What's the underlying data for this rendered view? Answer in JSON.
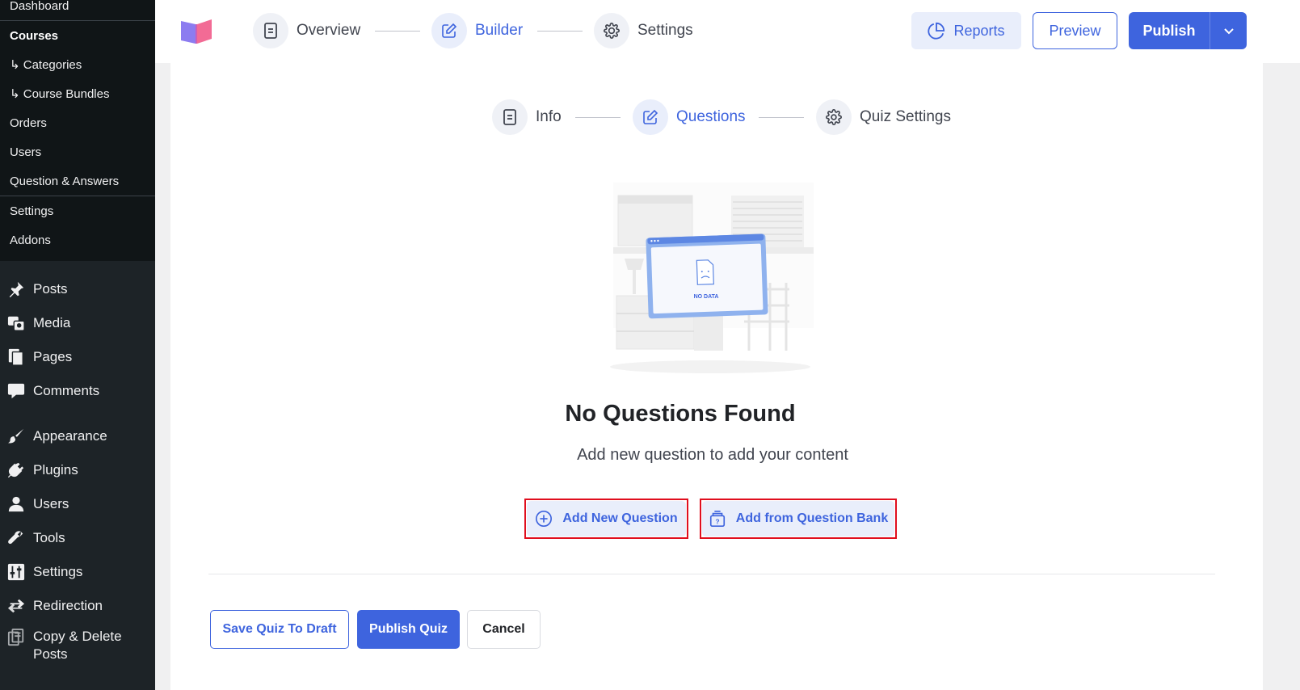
{
  "sidebar": {
    "submenu": [
      {
        "label": "Dashboard",
        "current": false
      },
      {
        "label": "Courses",
        "current": true
      },
      {
        "label": "↳ Categories",
        "current": false
      },
      {
        "label": "↳ Course Bundles",
        "current": false
      },
      {
        "label": "Orders",
        "current": false
      },
      {
        "label": "Users",
        "current": false
      },
      {
        "label": "Question & Answers",
        "current": false
      },
      {
        "label": "Settings",
        "current": false
      },
      {
        "label": "Addons",
        "current": false
      }
    ],
    "menu": [
      {
        "label": "Posts",
        "icon": "pin-icon"
      },
      {
        "label": "Media",
        "icon": "media-icon"
      },
      {
        "label": "Pages",
        "icon": "pages-icon"
      },
      {
        "label": "Comments",
        "icon": "comment-icon"
      },
      {
        "label": "Appearance",
        "icon": "brush-icon"
      },
      {
        "label": "Plugins",
        "icon": "plug-icon"
      },
      {
        "label": "Users",
        "icon": "user-icon"
      },
      {
        "label": "Tools",
        "icon": "wrench-icon"
      },
      {
        "label": "Settings",
        "icon": "sliders-icon"
      },
      {
        "label": "Redirection",
        "icon": "redirect-icon"
      },
      {
        "label": "Copy & Delete Posts",
        "icon": "copy-icon"
      }
    ]
  },
  "header": {
    "steps": [
      {
        "label": "Overview",
        "icon": "document-icon",
        "active": false
      },
      {
        "label": "Builder",
        "icon": "edit-icon",
        "active": true
      },
      {
        "label": "Settings",
        "icon": "gear-icon",
        "active": false
      }
    ],
    "reports_label": "Reports",
    "preview_label": "Preview",
    "publish_label": "Publish"
  },
  "quiz_steps": [
    {
      "label": "Info",
      "icon": "document-icon",
      "active": false
    },
    {
      "label": "Questions",
      "icon": "edit-icon",
      "active": true
    },
    {
      "label": "Quiz Settings",
      "icon": "gear-icon",
      "active": false
    }
  ],
  "empty_state": {
    "illustration_text": "NO DATA",
    "title": "No Questions Found",
    "subtitle": "Add new question to add your content"
  },
  "actions": {
    "add_new": "Add New Question",
    "add_from_bank": "Add from Question Bank"
  },
  "footer": {
    "save_draft": "Save Quiz To Draft",
    "publish_quiz": "Publish Quiz",
    "cancel": "Cancel"
  },
  "colors": {
    "accent": "#3e64de",
    "highlight_outline": "#e00e1e",
    "sidebar_bg": "#1d2327"
  }
}
